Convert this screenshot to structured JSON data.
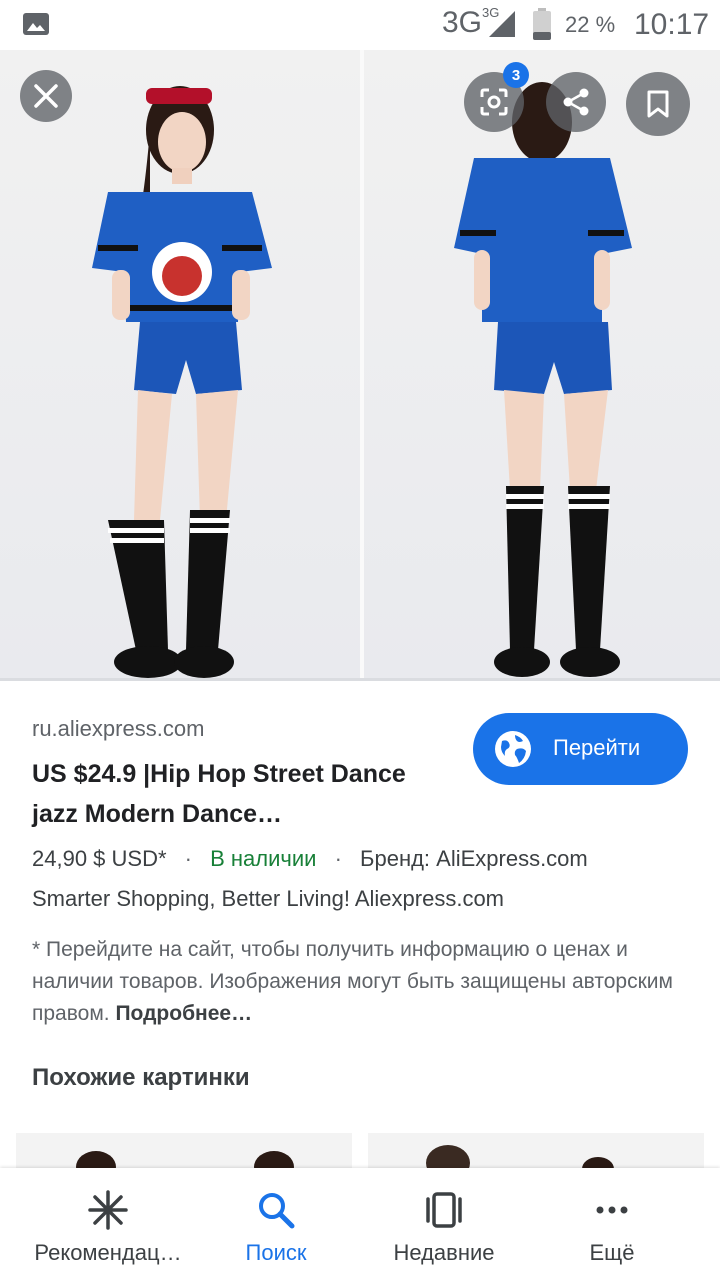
{
  "status_bar": {
    "network": "3G",
    "network_small": "3G",
    "battery": "22 %",
    "time": "10:17"
  },
  "viewer": {
    "lens_badge_count": "3",
    "icons": [
      "close-icon",
      "lens-icon",
      "share-icon",
      "bookmark-icon"
    ]
  },
  "result": {
    "source": "ru.aliexpress.com",
    "title_line1": "US $24.9 |Hip Hop Street Dance",
    "title_line2": "jazz Modern Dance…",
    "visit_label": "Перейти",
    "price": "24,90 $ USD*",
    "availability": "В наличии",
    "brand": "Бренд: AliExpress.com",
    "tagline": "Smarter Shopping, Better Living! Aliexpress.com",
    "disclaimer": "* Перейдите на сайт, чтобы получить информацию о ценах и наличии товаров. Изображения могут быть защищены авторским правом.",
    "more_label": "Подробнее…",
    "dot": "·"
  },
  "similar": {
    "title": "Похожие картинки"
  },
  "bottom_nav": {
    "items": [
      {
        "label": "Рекомендац…",
        "icon": "asterisk-icon"
      },
      {
        "label": "Поиск",
        "icon": "search-icon"
      },
      {
        "label": "Недавние",
        "icon": "recent-tabs-icon"
      },
      {
        "label": "Ещё",
        "icon": "more-dots-icon"
      }
    ]
  },
  "colors": {
    "accent": "#1a73e8",
    "in_stock": "#188038",
    "text_primary": "#202124",
    "text_secondary": "#5f6368"
  }
}
